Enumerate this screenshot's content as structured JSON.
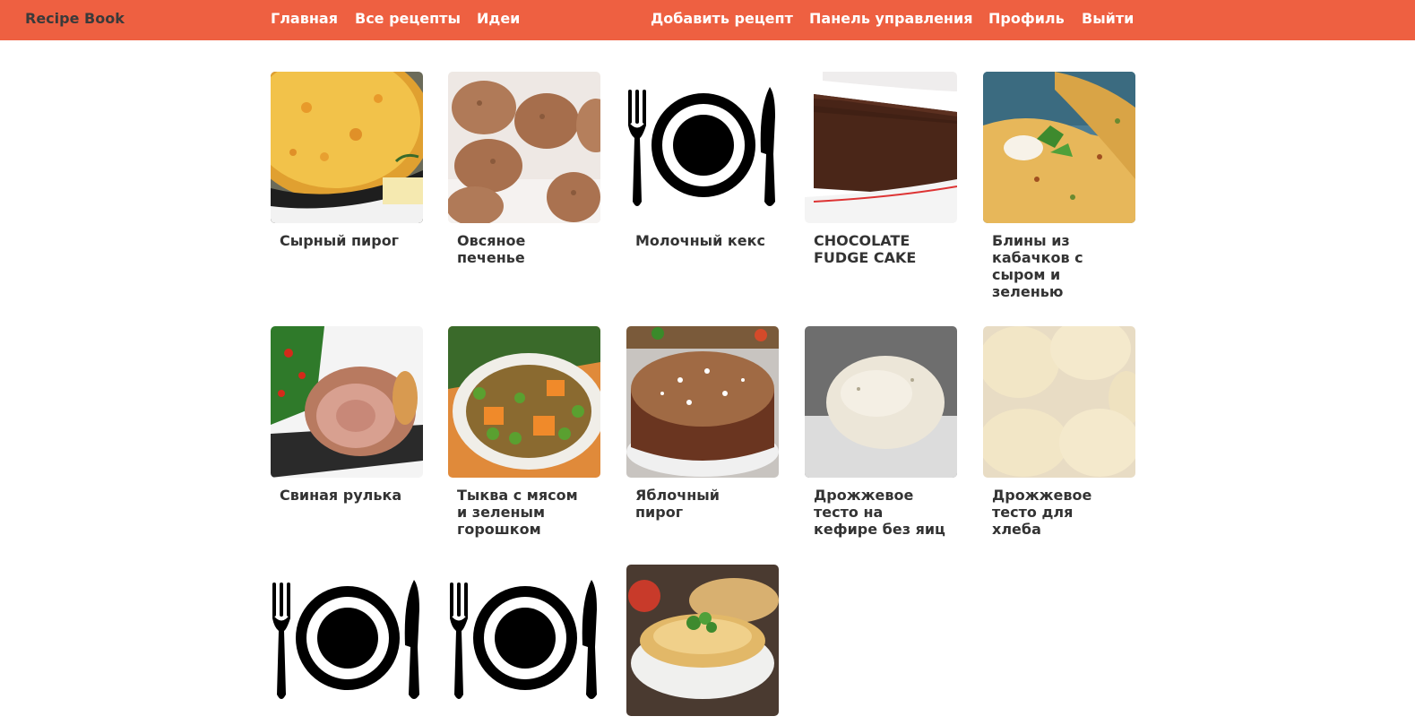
{
  "app": {
    "brand": "Recipe Book"
  },
  "nav": {
    "left": [
      "Главная",
      "Все рецепты",
      "Идеи"
    ],
    "right": [
      "Добавить рецепт",
      "Панель управления",
      "Профиль",
      "Выйти"
    ]
  },
  "colors": {
    "navbar": "#ee6041",
    "brand_text": "#3a3a3a",
    "nav_text": "#ffffff",
    "title_text": "#333333"
  },
  "recipes": [
    {
      "title": "Сырный пирог",
      "image": "cheese-pie-photo"
    },
    {
      "title": "Овсяное печенье",
      "image": "oatmeal-cookies-photo"
    },
    {
      "title": "Молочный кекс",
      "image": "plate-cutlery-icon"
    },
    {
      "title": "CHOCOLATE FUDGE CAKE",
      "image": "chocolate-cake-photo"
    },
    {
      "title": "Блины из кабачков с сыром и зеленью",
      "image": "zucchini-pancakes-photo"
    },
    {
      "title": "Свиная рулька",
      "image": "pork-knuckle-photo"
    },
    {
      "title": "Тыква с мясом и зеленым горошком",
      "image": "pumpkin-meat-peas-photo"
    },
    {
      "title": "Яблочный пирог",
      "image": "apple-pie-photo"
    },
    {
      "title": "Дрожжевое тесто на кефире без яиц",
      "image": "dough-ball-photo"
    },
    {
      "title": "Дрожжевое тесто для хлеба",
      "image": "dough-buns-photo"
    },
    {
      "title": "",
      "image": "plate-cutlery-icon"
    },
    {
      "title": "",
      "image": "plate-cutlery-icon"
    },
    {
      "title": "",
      "image": "flatbread-photo"
    }
  ]
}
